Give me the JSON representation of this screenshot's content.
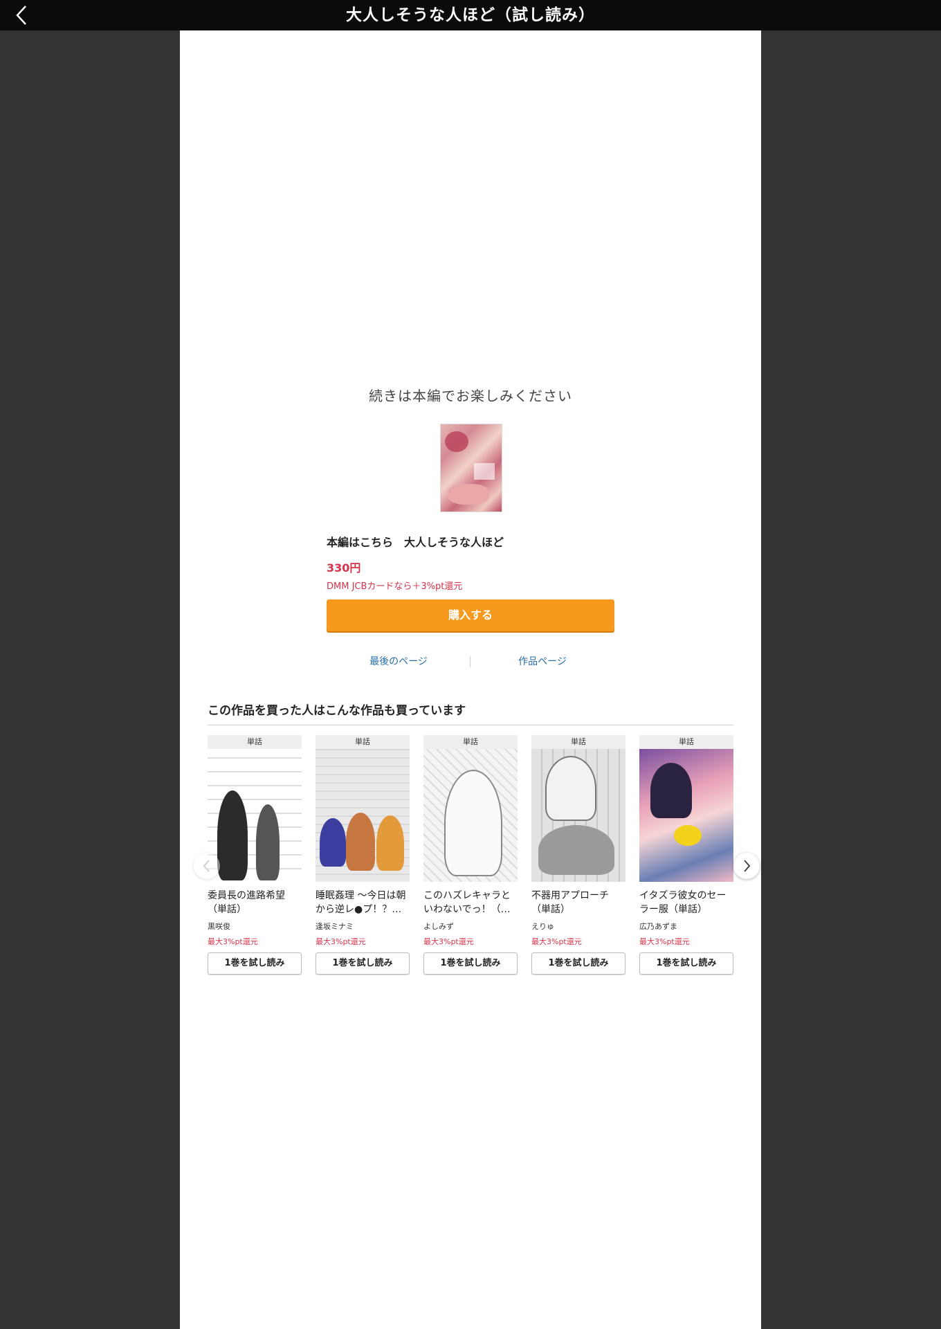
{
  "header": {
    "title": "大人しそうな人ほど（試し読み）",
    "back_icon": "chevron-left-icon"
  },
  "end_panel": {
    "message": "続きは本編でお楽しみください",
    "main_title": "本編はこちら　大人しそうな人ほど",
    "price": "330円",
    "point_note": "DMM JCBカードなら＋3%pt還元",
    "buy_label": "購入する",
    "last_page_label": "最後のページ",
    "work_page_label": "作品ページ",
    "colors": {
      "accent": "#f7991c",
      "price": "#d6334b",
      "link": "#2a6fa6"
    }
  },
  "recommendations": {
    "heading": "この作品を買った人はこんな作品も買っています",
    "items": [
      {
        "badge": "単話",
        "name": "委員長の進路希望（単話）",
        "author": "黒咲俊",
        "point": "最大3%pt還元",
        "button": "1巻を試し読み"
      },
      {
        "badge": "単話",
        "name": "睡眠姦理 〜今日は朝から逆レ●プ！？…",
        "author": "逢坂ミナミ",
        "point": "最大3%pt還元",
        "button": "1巻を試し読み"
      },
      {
        "badge": "単話",
        "name": "このハズレキャラといわないでっ！（…",
        "author": "よしみず",
        "point": "最大3%pt還元",
        "button": "1巻を試し読み"
      },
      {
        "badge": "単話",
        "name": "不器用アプローチ（単話）",
        "author": "えりゅ",
        "point": "最大3%pt還元",
        "button": "1巻を試し読み"
      },
      {
        "badge": "単話",
        "name": "イタズラ彼女のセーラー服（単話）",
        "author": "広乃あずま",
        "point": "最大3%pt還元",
        "button": "1巻を試し読み"
      }
    ]
  }
}
